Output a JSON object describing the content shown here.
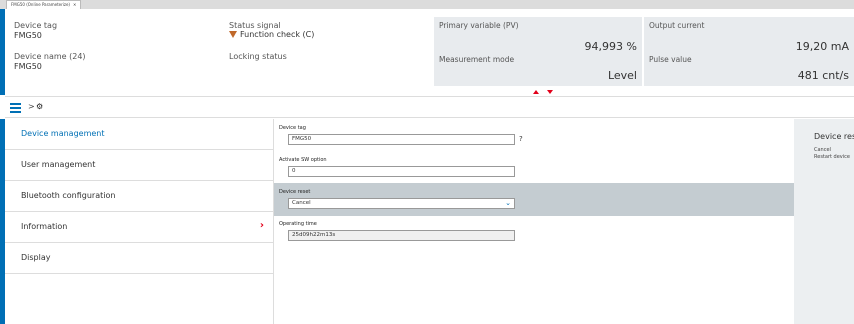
{
  "tab": {
    "title": "FMG50 (Online Parameterize)",
    "close": "✕"
  },
  "header": {
    "device_tag_label": "Device tag",
    "device_tag_value": "FMG50",
    "device_name_label": "Device name (24)",
    "device_name_value": "FMG50",
    "status_signal_label": "Status signal",
    "status_signal_value": "Function check (C)",
    "locking_status_label": "Locking status"
  },
  "process_values": {
    "primary_variable": {
      "label": "Primary variable (PV)",
      "value": "94,993 %"
    },
    "output_current": {
      "label": "Output current",
      "value": "19,20 mA"
    },
    "measurement_mode": {
      "label": "Measurement mode",
      "value": "Level"
    },
    "pulse_value": {
      "label": "Pulse value",
      "value": "481 cnt/s"
    }
  },
  "breadcrumb": {
    "separator": ">",
    "settings_icon": "⚙"
  },
  "menu": {
    "items": [
      {
        "label": "Device management"
      },
      {
        "label": "User management"
      },
      {
        "label": "Bluetooth configuration"
      },
      {
        "label": "Information"
      },
      {
        "label": "Display"
      }
    ],
    "chevron": "›"
  },
  "form": {
    "device_tag": {
      "label": "Device tag",
      "value": "FMG50",
      "help": "?"
    },
    "activate_sw": {
      "label": "Activate SW option",
      "value": "0"
    },
    "device_reset": {
      "label": "Device reset",
      "value": "Cancel",
      "chevron": "⌄"
    },
    "operating_time": {
      "label": "Operating time",
      "value": "25d09h22m13s"
    }
  },
  "help_panel": {
    "title": "Device reset",
    "options": [
      "Cancel",
      "Restart device"
    ]
  },
  "colors": {
    "accent": "#006fb5",
    "alert": "#e2001a",
    "warning": "#c0682a",
    "panel": "#e8ebee"
  }
}
